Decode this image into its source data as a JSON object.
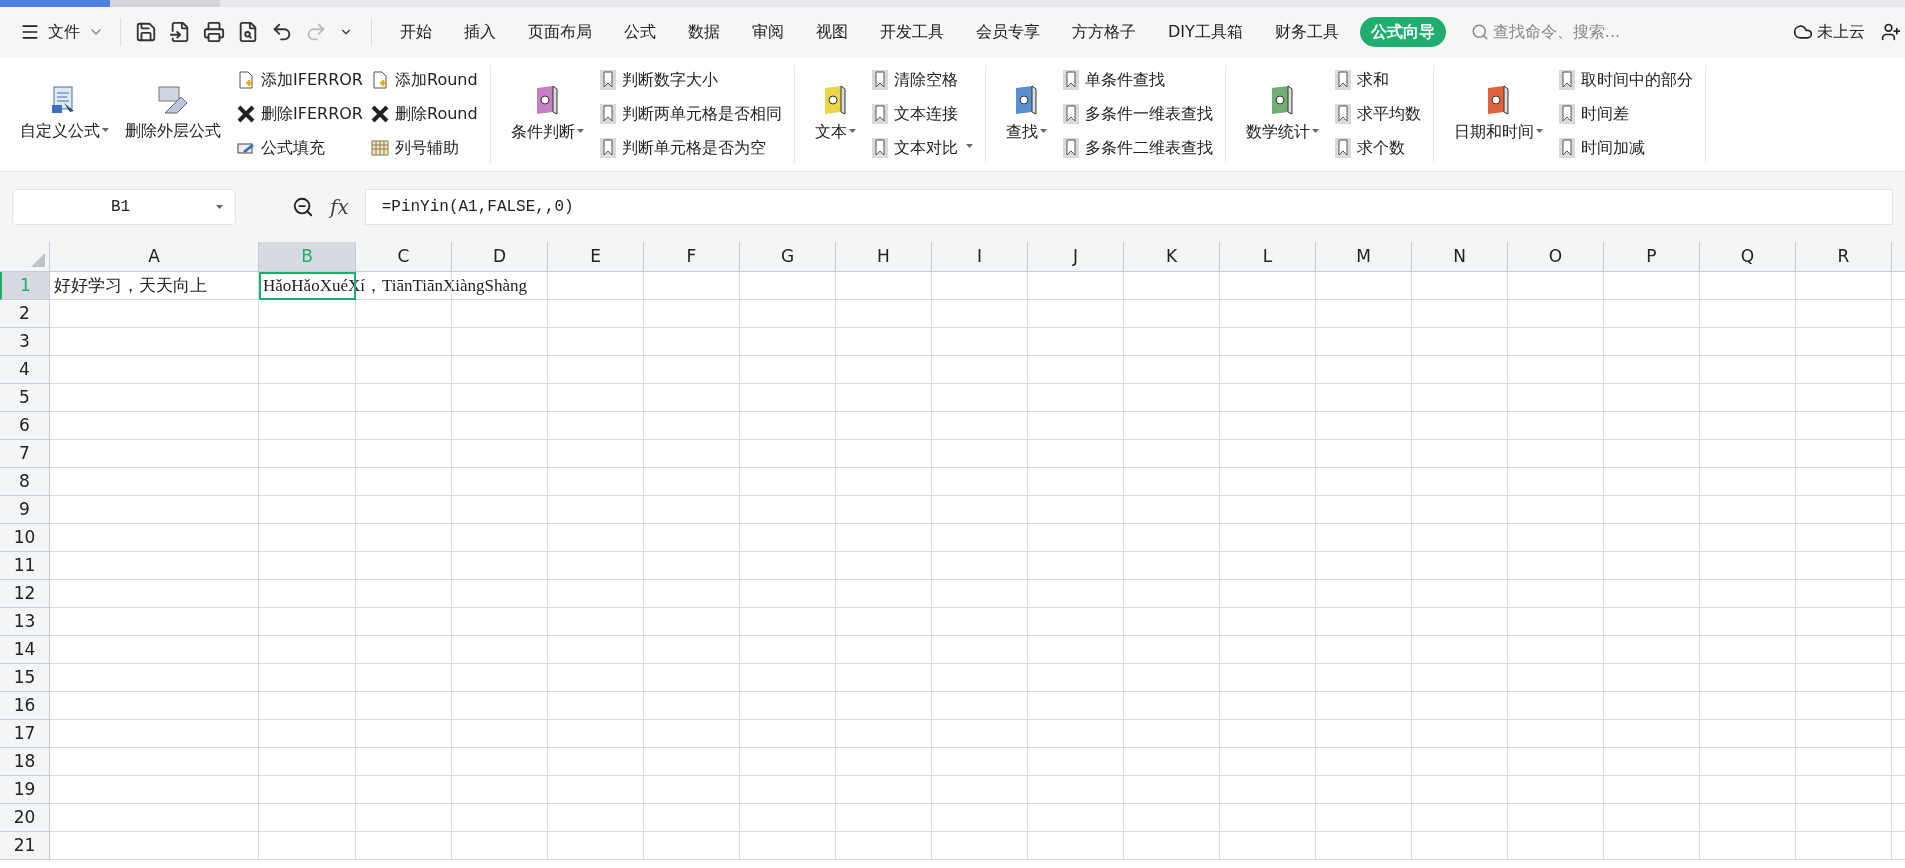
{
  "menu": {
    "file": "文件",
    "quick_actions": [
      {
        "kind": "save",
        "disabled": false
      },
      {
        "kind": "export",
        "disabled": false
      },
      {
        "kind": "print",
        "disabled": false
      },
      {
        "kind": "preview",
        "disabled": false
      },
      {
        "kind": "undo",
        "disabled": false
      },
      {
        "kind": "redo",
        "disabled": true
      },
      {
        "kind": "more",
        "disabled": false
      }
    ],
    "tabs": [
      {
        "label": "开始",
        "selected": false
      },
      {
        "label": "插入",
        "selected": false
      },
      {
        "label": "页面布局",
        "selected": false
      },
      {
        "label": "公式",
        "selected": false
      },
      {
        "label": "数据",
        "selected": false
      },
      {
        "label": "审阅",
        "selected": false
      },
      {
        "label": "视图",
        "selected": false
      },
      {
        "label": "开发工具",
        "selected": false
      },
      {
        "label": "会员专享",
        "selected": false
      },
      {
        "label": "方方格子",
        "selected": false
      },
      {
        "label": "DIY工具箱",
        "selected": false
      },
      {
        "label": "财务工具",
        "selected": false
      },
      {
        "label": "公式向导",
        "selected": true
      }
    ],
    "search": {
      "placeholder": "查找命令、搜索..."
    },
    "cloud": "未上云"
  },
  "ribbon": [
    {
      "big": [
        {
          "label": "自定义公式",
          "kind": "formula",
          "dropdown": true
        },
        {
          "label": "删除外层公式",
          "kind": "erase",
          "dropdown": false
        }
      ],
      "small": [
        [
          {
            "label": "添加IFERROR",
            "kind": "add",
            "dropdown": false
          },
          {
            "label": "删除IFERROR",
            "kind": "delete",
            "dropdown": false
          },
          {
            "label": "公式填充",
            "kind": "fill",
            "dropdown": false
          }
        ],
        [
          {
            "label": "添加Round",
            "kind": "add",
            "dropdown": false
          },
          {
            "label": "删除Round",
            "kind": "delete",
            "dropdown": false
          },
          {
            "label": "列号辅助",
            "kind": "grid",
            "dropdown": false
          }
        ]
      ]
    },
    {
      "big": [
        {
          "label": "条件判断",
          "kind": "book",
          "color": "#c77fc4",
          "dropdown": true
        }
      ],
      "small": [
        [
          {
            "label": "判断数字大小",
            "kind": "bookmark",
            "dropdown": false
          },
          {
            "label": "判断两单元格是否相同",
            "kind": "bookmark",
            "dropdown": false
          },
          {
            "label": "判断单元格是否为空",
            "kind": "bookmark",
            "dropdown": false
          }
        ]
      ]
    },
    {
      "big": [
        {
          "label": "文本",
          "kind": "book",
          "color": "#e8d84a",
          "dropdown": true
        }
      ],
      "small": [
        [
          {
            "label": "清除空格",
            "kind": "bookmark",
            "dropdown": false
          },
          {
            "label": "文本连接",
            "kind": "bookmark",
            "dropdown": false
          },
          {
            "label": "文本对比",
            "kind": "bookmark",
            "dropdown": true
          }
        ]
      ]
    },
    {
      "big": [
        {
          "label": "查找",
          "kind": "book",
          "color": "#5b8fd1",
          "dropdown": true
        }
      ],
      "small": [
        [
          {
            "label": "单条件查找",
            "kind": "bookmark",
            "dropdown": false
          },
          {
            "label": "多条件一维表查找",
            "kind": "bookmark",
            "dropdown": false
          },
          {
            "label": "多条件二维表查找",
            "kind": "bookmark",
            "dropdown": false
          }
        ]
      ]
    },
    {
      "big": [
        {
          "label": "数学统计",
          "kind": "book",
          "color": "#6fae74",
          "dropdown": true
        }
      ],
      "small": [
        [
          {
            "label": "求和",
            "kind": "bookmark",
            "dropdown": false
          },
          {
            "label": "求平均数",
            "kind": "bookmark",
            "dropdown": false
          },
          {
            "label": "求个数",
            "kind": "bookmark",
            "dropdown": false
          }
        ]
      ]
    },
    {
      "big": [
        {
          "label": "日期和时间",
          "kind": "book",
          "color": "#e0623a",
          "dropdown": true
        }
      ],
      "small": [
        [
          {
            "label": "取时间中的部分",
            "kind": "bookmark",
            "dropdown": false
          },
          {
            "label": "时间差",
            "kind": "bookmark",
            "dropdown": false
          },
          {
            "label": "时间加减",
            "kind": "bookmark",
            "dropdown": false
          }
        ]
      ]
    }
  ],
  "formula_bar": {
    "name_box": "B1",
    "fx": "fx",
    "formula": "=PinYin(A1,FALSE,,0)"
  },
  "sheet": {
    "columns": [
      {
        "label": "A",
        "selected": false
      },
      {
        "label": "B",
        "selected": true
      },
      {
        "label": "C",
        "selected": false
      },
      {
        "label": "D",
        "selected": false
      },
      {
        "label": "E",
        "selected": false
      },
      {
        "label": "F",
        "selected": false
      },
      {
        "label": "G",
        "selected": false
      },
      {
        "label": "H",
        "selected": false
      },
      {
        "label": "I",
        "selected": false
      },
      {
        "label": "J",
        "selected": false
      },
      {
        "label": "K",
        "selected": false
      },
      {
        "label": "L",
        "selected": false
      },
      {
        "label": "M",
        "selected": false
      },
      {
        "label": "N",
        "selected": false
      },
      {
        "label": "O",
        "selected": false
      },
      {
        "label": "P",
        "selected": false
      },
      {
        "label": "Q",
        "selected": false
      },
      {
        "label": "R",
        "selected": false
      }
    ],
    "rows": [
      {
        "label": "1",
        "selected": true,
        "cells": [
          {
            "text": "好好学习，天天向上",
            "selected": false
          },
          {
            "text": "HǎoHǎoXuéXí，TiānTiānXiàngShàng",
            "selected": true
          }
        ]
      },
      {
        "label": "2",
        "selected": false
      },
      {
        "label": "3",
        "selected": false
      },
      {
        "label": "4",
        "selected": false
      },
      {
        "label": "5",
        "selected": false
      },
      {
        "label": "6",
        "selected": false
      },
      {
        "label": "7",
        "selected": false
      },
      {
        "label": "8",
        "selected": false
      },
      {
        "label": "9",
        "selected": false
      },
      {
        "label": "10",
        "selected": false
      },
      {
        "label": "11",
        "selected": false
      },
      {
        "label": "12",
        "selected": false
      },
      {
        "label": "13",
        "selected": false
      },
      {
        "label": "14",
        "selected": false
      },
      {
        "label": "15",
        "selected": false
      },
      {
        "label": "16",
        "selected": false
      },
      {
        "label": "17",
        "selected": false
      },
      {
        "label": "18",
        "selected": false
      },
      {
        "label": "19",
        "selected": false
      },
      {
        "label": "20",
        "selected": false
      },
      {
        "label": "21",
        "selected": false
      }
    ]
  }
}
